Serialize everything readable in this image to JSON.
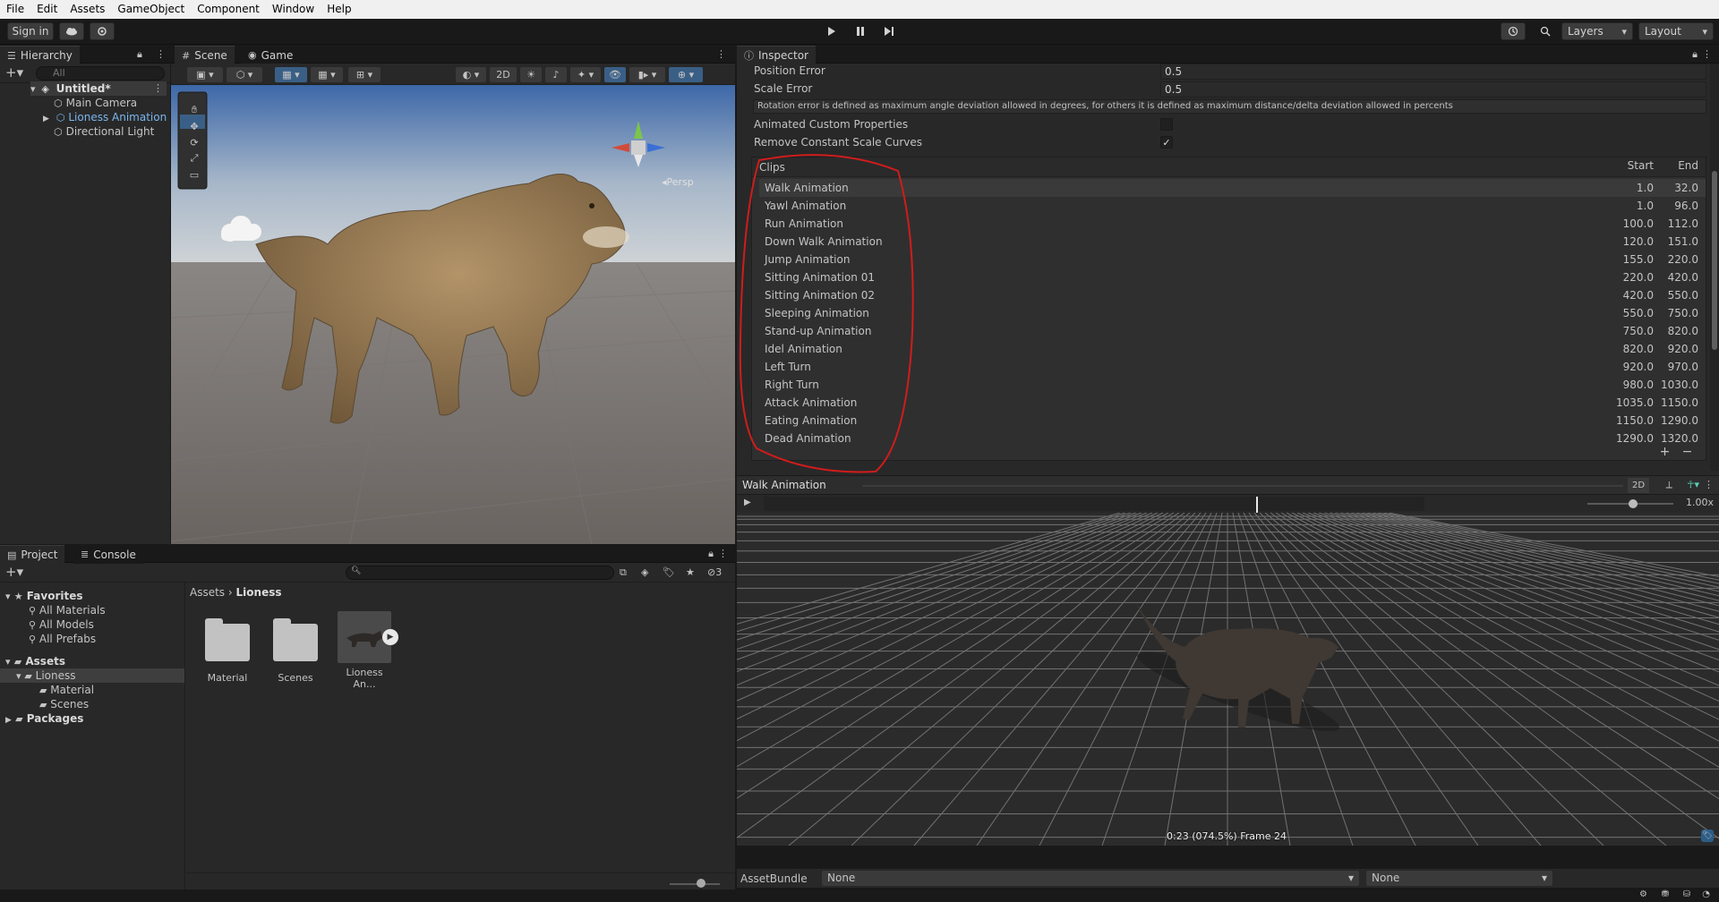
{
  "menu": [
    "File",
    "Edit",
    "Assets",
    "GameObject",
    "Component",
    "Window",
    "Help"
  ],
  "toolbar": {
    "sign_in": "Sign in",
    "layers": "Layers",
    "layout": "Layout"
  },
  "hierarchy": {
    "tab": "Hierarchy",
    "search_placeholder": "All",
    "scene": "Untitled*",
    "items": [
      "Main Camera",
      "Lioness Animation",
      "Directional Light"
    ]
  },
  "scene_view": {
    "tabs": [
      "Scene",
      "Game"
    ],
    "mode_2d": "2D",
    "persp": "Persp"
  },
  "project": {
    "tabs": [
      "Project",
      "Console"
    ],
    "hidden_count": "3",
    "tree": {
      "favorites": "Favorites",
      "fav_items": [
        "All Materials",
        "All Models",
        "All Prefabs"
      ],
      "assets": "Assets",
      "lioness": "Lioness",
      "lioness_children": [
        "Material",
        "Scenes"
      ],
      "packages": "Packages"
    },
    "breadcrumb": [
      "Assets",
      "Lioness"
    ],
    "files": [
      "Material",
      "Scenes",
      "Lioness An..."
    ]
  },
  "inspector": {
    "tab": "Inspector",
    "position_error_label": "Position Error",
    "position_error": "0.5",
    "scale_error_label": "Scale Error",
    "scale_error": "0.5",
    "help_text": "Rotation error is defined as maximum angle deviation allowed in degrees, for others it is defined as maximum distance/delta deviation allowed in percents",
    "animated_custom_label": "Animated Custom Properties",
    "animated_custom_checked": false,
    "remove_constant_label": "Remove Constant Scale Curves",
    "remove_constant_checked": true,
    "clips_header": "Clips",
    "start_header": "Start",
    "end_header": "End",
    "clips": [
      {
        "name": "Walk Animation",
        "start": "1.0",
        "end": "32.0"
      },
      {
        "name": "Yawl Animation",
        "start": "1.0",
        "end": "96.0"
      },
      {
        "name": "Run Animation",
        "start": "100.0",
        "end": "112.0"
      },
      {
        "name": "Down Walk Animation",
        "start": "120.0",
        "end": "151.0"
      },
      {
        "name": "Jump Animation",
        "start": "155.0",
        "end": "220.0"
      },
      {
        "name": "Sitting Animation 01",
        "start": "220.0",
        "end": "420.0"
      },
      {
        "name": "Sitting Animation 02",
        "start": "420.0",
        "end": "550.0"
      },
      {
        "name": "Sleeping Animation",
        "start": "550.0",
        "end": "750.0"
      },
      {
        "name": "Stand-up Animation",
        "start": "750.0",
        "end": "820.0"
      },
      {
        "name": "Idel Animation",
        "start": "820.0",
        "end": "920.0"
      },
      {
        "name": "Left Turn",
        "start": "920.0",
        "end": "970.0"
      },
      {
        "name": "Right Turn",
        "start": "980.0",
        "end": "1030.0"
      },
      {
        "name": "Attack Animation",
        "start": "1035.0",
        "end": "1150.0"
      },
      {
        "name": "Eating Animation",
        "start": "1150.0",
        "end": "1290.0"
      },
      {
        "name": "Dead Animation",
        "start": "1290.0",
        "end": "1320.0"
      }
    ],
    "clip_add": "+",
    "clip_remove": "−"
  },
  "preview": {
    "title": "Walk Animation",
    "mode_2d": "2D",
    "speed": "1.00x",
    "progress": 0.745,
    "status": "0:23 (074.5%) Frame 24"
  },
  "assetbundle": {
    "label": "AssetBundle",
    "name": "None",
    "variant": "None"
  },
  "colors": {
    "selection": "#2c5d87",
    "accent": "#5aa0e6",
    "annotation": "#d01c1c"
  }
}
